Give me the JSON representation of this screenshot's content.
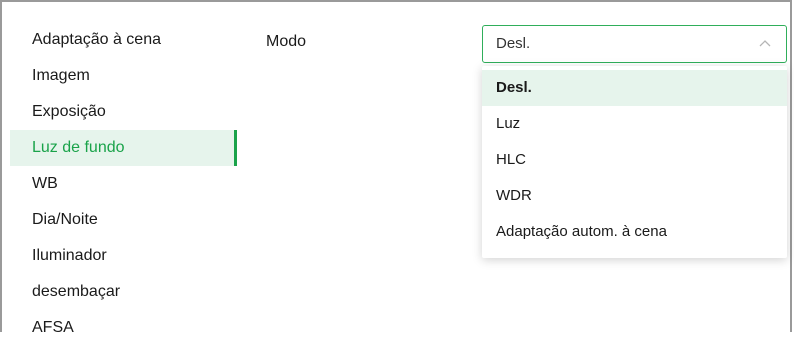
{
  "sidebar": {
    "items": [
      {
        "label": "Adaptação à cena",
        "active": false
      },
      {
        "label": "Imagem",
        "active": false
      },
      {
        "label": "Exposição",
        "active": false
      },
      {
        "label": "Luz de fundo",
        "active": true
      },
      {
        "label": "WB",
        "active": false
      },
      {
        "label": "Dia/Noite",
        "active": false
      },
      {
        "label": "Iluminador",
        "active": false
      },
      {
        "label": "desembaçar",
        "active": false
      },
      {
        "label": "AFSA",
        "active": false
      }
    ]
  },
  "main": {
    "mode_label": "Modo",
    "mode_select": {
      "value": "Desl.",
      "expanded": true,
      "options": [
        "Desl.",
        "Luz",
        "HLC",
        "WDR",
        "Adaptação autom. à cena"
      ],
      "selected_index": 0
    }
  },
  "colors": {
    "accent": "#1aa34a",
    "active_bg": "#e6f4ec",
    "select_border": "#2fae5a"
  },
  "icons": {
    "select_chevron": "chevron-up-icon"
  }
}
